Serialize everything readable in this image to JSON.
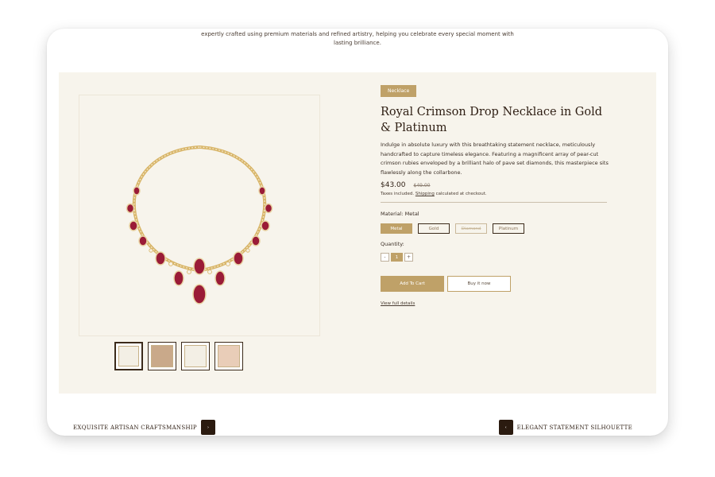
{
  "intro": {
    "line1": "expertly crafted using premium materials and refined artistry, helping you celebrate every special moment with",
    "line2": "lasting brilliance."
  },
  "product": {
    "badge": "Necklace",
    "title": "Royal Crimson Drop Necklace in Gold & Platinum",
    "description": "Indulge in absolute luxury with this breathtaking statement necklace, meticulously handcrafted to capture timeless elegance. Featuring a magnificent array of pear-cut crimson rubies enveloped by a brilliant halo of pave set diamonds, this masterpiece sits flawlessly along the collarbone.",
    "price": "$43.00",
    "compare_price": "$49.00",
    "tax_prefix": "Taxes included.",
    "tax_link": "Shipping",
    "tax_suffix": "calculated at checkout.",
    "material_label": "Material: Metal",
    "materials": [
      {
        "label": "Metal",
        "state": "selected"
      },
      {
        "label": "Gold",
        "state": "normal"
      },
      {
        "label": "Diamond",
        "state": "disabled"
      },
      {
        "label": "Platinum",
        "state": "normal"
      }
    ],
    "quantity_label": "Quantity:",
    "quantity": "1",
    "minus": "-",
    "plus": "+",
    "add_to_cart": "Add To Cart",
    "buy_now": "Buy it now",
    "view_details": "View full details"
  },
  "bottom": {
    "left_text": "EXQUISITE ARTISAN CRAFTSMANSHIP",
    "left_arrow": "›",
    "right_arrow": "‹",
    "right_text": "ELEGANT STATEMENT SILHOUETTE"
  },
  "colors": {
    "accent": "#bfa168",
    "panel_bg": "#f7f4ec",
    "dark": "#2b1b10",
    "ruby": "#9a1b37",
    "gold": "#d8b568"
  }
}
